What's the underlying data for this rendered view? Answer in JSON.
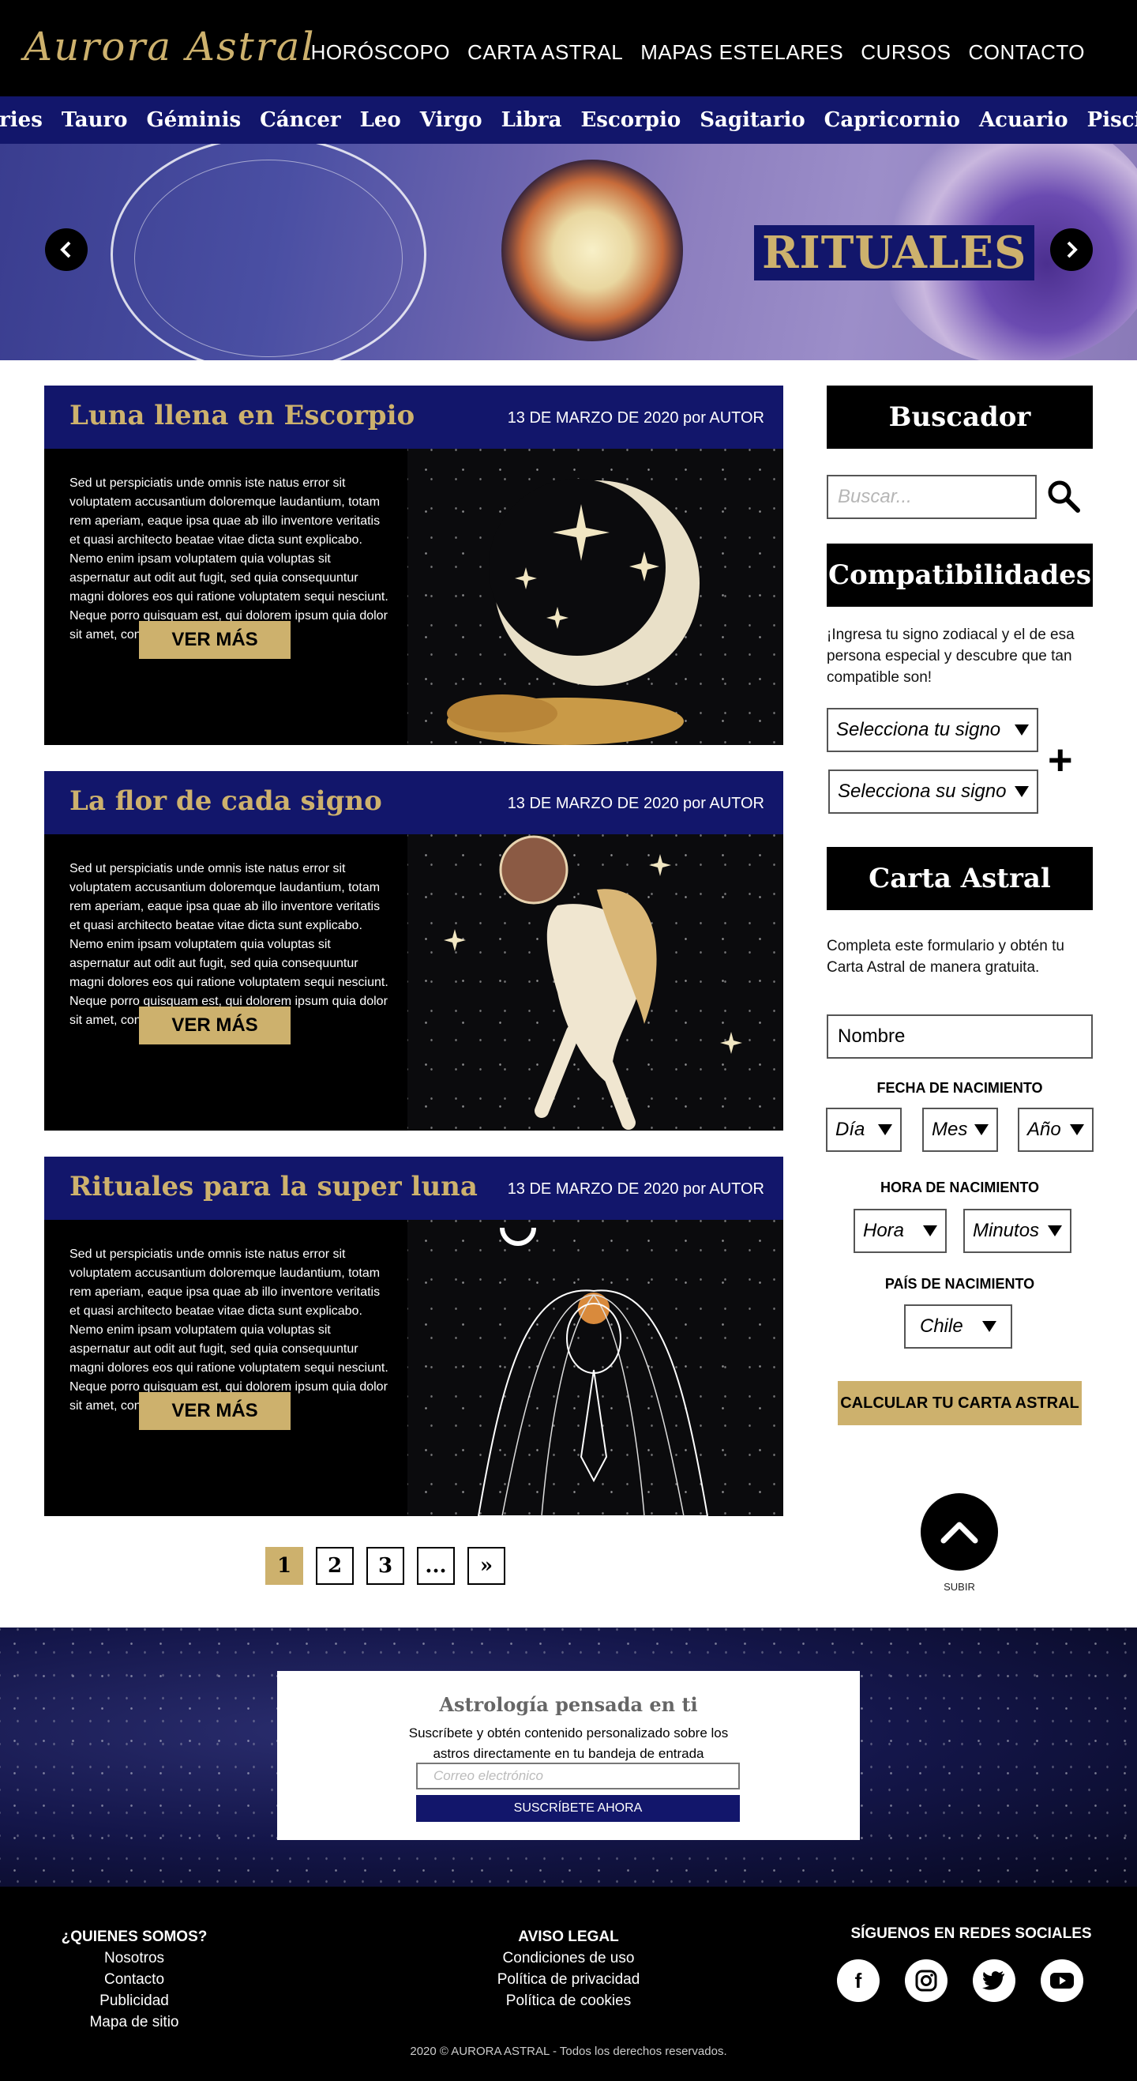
{
  "header": {
    "logo": "Aurora Astral",
    "nav": [
      "HORÓSCOPO",
      "CARTA ASTRAL",
      "MAPAS ESTELARES",
      "CURSOS",
      "CONTACTO"
    ]
  },
  "signs": [
    "Aries",
    "Tauro",
    "Géminis",
    "Cáncer",
    "Leo",
    "Virgo",
    "Libra",
    "Escorpio",
    "Sagitario",
    "Capricornio",
    "Acuario",
    "Piscis"
  ],
  "hero": {
    "title": "RITUALES",
    "prev_icon": "chevron-left-icon",
    "next_icon": "chevron-right-icon"
  },
  "posts": [
    {
      "title": "Luna llena en Escorpio",
      "meta": "13 DE MARZO DE 2020 por AUTOR",
      "text": "Sed ut perspiciatis unde omnis iste natus error sit voluptatem accusantium doloremque laudantium, totam rem aperiam, eaque ipsa quae ab illo inventore veritatis et quasi architecto beatae vitae dicta sunt explicabo. Nemo enim ipsam voluptatem quia voluptas sit aspernatur aut odit aut fugit, sed quia consequuntur magni dolores eos qui ratione voluptatem sequi nesciunt. Neque porro quisquam est, qui dolorem ipsum quia dolor sit amet, consectetur, adipisci",
      "button": "VER MÁS"
    },
    {
      "title": "La flor de cada signo",
      "meta": "13 DE MARZO DE 2020 por AUTOR",
      "text": "Sed ut perspiciatis unde omnis iste natus error sit voluptatem accusantium doloremque laudantium, totam rem aperiam, eaque ipsa quae ab illo inventore veritatis et quasi architecto beatae vitae dicta sunt explicabo. Nemo enim ipsam voluptatem quia voluptas sit aspernatur aut odit aut fugit, sed quia consequuntur magni dolores eos qui ratione voluptatem sequi nesciunt. Neque porro quisquam est, qui dolorem ipsum quia dolor sit amet, consectetur, adipisci",
      "button": "VER MÁS"
    },
    {
      "title": "Rituales para la super luna",
      "meta": "13 DE MARZO DE 2020 por AUTOR",
      "text": "Sed ut perspiciatis unde omnis iste natus error sit voluptatem accusantium doloremque laudantium, totam rem aperiam, eaque ipsa quae ab illo inventore veritatis et quasi architecto beatae vitae dicta sunt explicabo. Nemo enim ipsam voluptatem quia voluptas sit aspernatur aut odit aut fugit, sed quia consequuntur magni dolores eos qui ratione voluptatem sequi nesciunt. Neque porro quisquam est, qui dolorem ipsum quia dolor sit amet, consectetur, adipisci",
      "button": "VER MÁS"
    }
  ],
  "pagination": [
    "1",
    "2",
    "3",
    "...",
    "»"
  ],
  "sidebar": {
    "search_title": "Buscador",
    "search_placeholder": "Buscar...",
    "compat_title": "Compatibilidades",
    "compat_desc": "¡Ingresa tu signo zodiacal y el de esa persona especial y descubre que tan compatible son!",
    "select_mine": "Selecciona tu signo",
    "select_theirs": "Selecciona su signo",
    "plus": "+",
    "chart_title": "Carta Astral",
    "chart_desc": "Completa este formulario y obtén tu Carta Astral de manera gratuita.",
    "name_placeholder": "Nombre",
    "birth_date_label": "FECHA DE NACIMIENTO",
    "day": "Día",
    "month": "Mes",
    "year": "Año",
    "birth_time_label": "HORA DE NACIMIENTO",
    "hour": "Hora",
    "minutes": "Minutos",
    "country_label": "PAÍS DE NACIMIENTO",
    "country": "Chile",
    "calc_button": "CALCULAR TU CARTA ASTRAL",
    "up_label": "SUBIR"
  },
  "newsletter": {
    "title": "Astrología pensada en ti",
    "desc": "Suscríbete y obtén contenido personalizado sobre los astros directamente en tu bandeja de entrada",
    "email_placeholder": "Correo electrónico",
    "button": "SUSCRÍBETE AHORA"
  },
  "footer": {
    "about_title": "¿QUIENES SOMOS?",
    "about_links": [
      "Nosotros",
      "Contacto",
      "Publicidad",
      "Mapa de sitio"
    ],
    "legal_title": "AVISO LEGAL",
    "legal_links": [
      "Condiciones de uso",
      "Política de privacidad",
      "Política de cookies"
    ],
    "social_title": "SÍGUENOS EN REDES SOCIALES",
    "social_icons": [
      "facebook-icon",
      "instagram-icon",
      "twitter-icon",
      "youtube-icon"
    ],
    "copyright": "2020 © AURORA ASTRAL  - Todos los derechos reservados."
  },
  "colors": {
    "gold": "#cdb16d",
    "navy": "#12166b",
    "black": "#000000"
  }
}
